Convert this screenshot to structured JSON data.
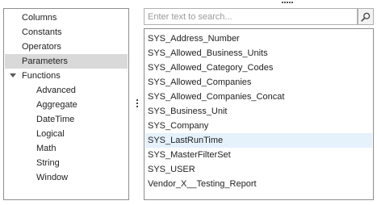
{
  "categories": {
    "items": [
      {
        "label": "Columns",
        "level": 0,
        "selected": false
      },
      {
        "label": "Constants",
        "level": 0,
        "selected": false
      },
      {
        "label": "Operators",
        "level": 0,
        "selected": false
      },
      {
        "label": "Parameters",
        "level": 0,
        "selected": true
      },
      {
        "label": "Functions",
        "level": 0,
        "selected": false,
        "expanded": true
      },
      {
        "label": "Advanced",
        "level": 1,
        "selected": false
      },
      {
        "label": "Aggregate",
        "level": 1,
        "selected": false
      },
      {
        "label": "DateTime",
        "level": 1,
        "selected": false
      },
      {
        "label": "Logical",
        "level": 1,
        "selected": false
      },
      {
        "label": "Math",
        "level": 1,
        "selected": false
      },
      {
        "label": "String",
        "level": 1,
        "selected": false
      },
      {
        "label": "Window",
        "level": 1,
        "selected": false
      }
    ]
  },
  "search": {
    "placeholder": "Enter text to search...",
    "value": ""
  },
  "parameters": {
    "items": [
      {
        "label": "SYS_Address_Number",
        "hovered": false
      },
      {
        "label": "SYS_Allowed_Business_Units",
        "hovered": false
      },
      {
        "label": "SYS_Allowed_Category_Codes",
        "hovered": false
      },
      {
        "label": "SYS_Allowed_Companies",
        "hovered": false
      },
      {
        "label": "SYS_Allowed_Companies_Concat",
        "hovered": false
      },
      {
        "label": "SYS_Business_Unit",
        "hovered": false
      },
      {
        "label": "SYS_Company",
        "hovered": false
      },
      {
        "label": "SYS_LastRunTime",
        "hovered": true
      },
      {
        "label": "SYS_MasterFilterSet",
        "hovered": false
      },
      {
        "label": "SYS_USER",
        "hovered": false
      },
      {
        "label": "Vendor_X__Testing_Report",
        "hovered": false
      }
    ]
  },
  "colors": {
    "selected_bg": "#d9d9d9",
    "hover_bg": "#e5f1fb",
    "border": "#8e8e8e"
  }
}
